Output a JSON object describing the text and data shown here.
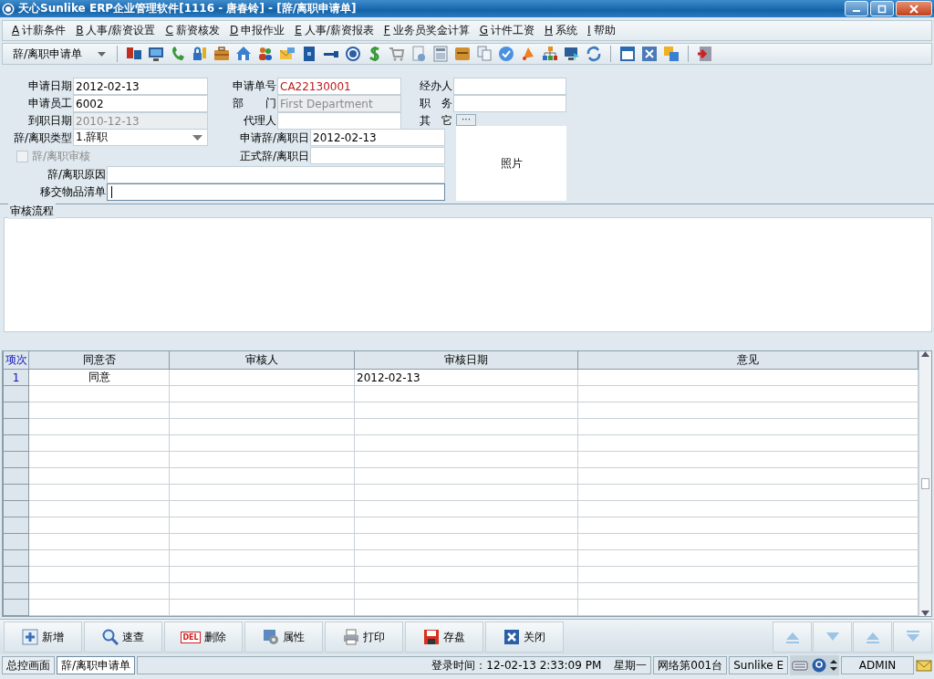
{
  "window": {
    "title": "天心Sunlike ERP企业管理软件[1116 - 唐春铃] - [辞/离职申请单]"
  },
  "menu": [
    {
      "key": "A",
      "label": "计薪条件"
    },
    {
      "key": "B",
      "label": "人事/薪资设置"
    },
    {
      "key": "C",
      "label": "薪资核发"
    },
    {
      "key": "D",
      "label": "申报作业"
    },
    {
      "key": "E",
      "label": "人事/薪资报表"
    },
    {
      "key": "F",
      "label": "业务员奖金计算"
    },
    {
      "key": "G",
      "label": "计件工资"
    },
    {
      "key": "H",
      "label": "系统"
    },
    {
      "key": "I",
      "label": "帮助"
    }
  ],
  "toolbar": {
    "form_selector": "辞/离职申请单"
  },
  "form": {
    "fields": [
      {
        "kind": "text",
        "label": "申请日期",
        "value": "2012-02-13",
        "disabled": false,
        "focused": false
      },
      {
        "kind": "doc_number",
        "label": "申请单号",
        "value": "CA22130001",
        "disabled": false,
        "focused": false
      },
      {
        "kind": "text",
        "label": "经办人",
        "disabled": false,
        "focused": false
      },
      {
        "kind": "text",
        "label": "申请员工",
        "value": "6002",
        "disabled": false,
        "focused": false
      },
      {
        "kind": "text",
        "label": "部　　门",
        "value": "First Department",
        "disabled": true,
        "focused": false
      },
      {
        "kind": "text",
        "label": "职　务",
        "disabled": false,
        "focused": false
      },
      {
        "kind": "text",
        "label": "到职日期",
        "value": "2010-12-13",
        "disabled": true,
        "focused": false
      },
      {
        "kind": "text",
        "label": "代理人",
        "disabled": false,
        "focused": false
      },
      {
        "kind": "button",
        "label": "其　它",
        "value": "···",
        "disabled": false,
        "focused": false
      },
      {
        "kind": "select",
        "label": "辞/离职类型",
        "value": "1.辞职",
        "disabled": false,
        "focused": false
      },
      {
        "kind": "text",
        "label": "申请辞/离职日",
        "value": "2012-02-13",
        "disabled": false,
        "focused": false
      },
      {
        "kind": "checkbox",
        "label": "辞/离职审核",
        "checked": false,
        "disabled": true,
        "focused": false
      },
      {
        "kind": "text",
        "label": "正式辞/离职日",
        "disabled": false,
        "focused": false
      },
      {
        "kind": "text",
        "label": "辞/离职原因",
        "disabled": false,
        "focused": false
      },
      {
        "kind": "text",
        "label": "移交物品清单",
        "disabled": false,
        "focused": true
      }
    ],
    "photo": {
      "label": "照片"
    }
  },
  "review_flow": {
    "title": "审核流程"
  },
  "table": {
    "columns": [
      "项次",
      "同意否",
      "审核人",
      "审核日期",
      "意见"
    ],
    "rows": [
      {
        "item": "1",
        "agree": "同意",
        "review_date": "2012-02-13"
      }
    ]
  },
  "buttons": [
    {
      "kind": "add",
      "label": "新增"
    },
    {
      "kind": "search",
      "label": "速查"
    },
    {
      "kind": "delete",
      "label": "删除",
      "icon_text": "DEL"
    },
    {
      "kind": "properties",
      "label": "属性"
    },
    {
      "kind": "print",
      "label": "打印"
    },
    {
      "kind": "save",
      "label": "存盘"
    },
    {
      "kind": "close",
      "label": "关闭"
    }
  ],
  "status_bar": {
    "tabs": [
      {
        "label": "总控画面",
        "selected": false
      },
      {
        "label": "辞/离职申请单",
        "selected": true
      }
    ],
    "login": "登录时间：12-02-13 2:33:09 PM",
    "weekday": "星期一",
    "station": "网络第001台",
    "company": "Sunlike E",
    "user": "ADMIN"
  }
}
